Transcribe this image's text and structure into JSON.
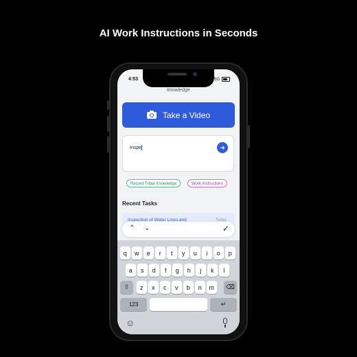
{
  "headline": "AI Work Instructions in Seconds",
  "status_bar": {
    "time": "4:53",
    "network": "5G",
    "icons": [
      "moon-icon",
      "signal-icon",
      "battery-icon"
    ]
  },
  "sub_label": "knowledge",
  "video_button": {
    "label": "Take a Video",
    "icon": "camera-icon"
  },
  "input": {
    "value": "Inspe",
    "send_icon": "arrow-right-icon"
  },
  "chips": [
    {
      "label": "Record Tribal Knowledge",
      "color": "#2f8c60"
    },
    {
      "label": "Work Instructions",
      "color": "#9c3e9e"
    }
  ],
  "recent": {
    "title": "Recent Tasks",
    "tasks": [
      {
        "name": "Inspection of Water Lines and",
        "date": "Today"
      }
    ]
  },
  "accessory": {
    "up": "⌃",
    "down": "⌄",
    "done": "✓"
  },
  "keyboard": {
    "row1": [
      "q",
      "w",
      "e",
      "r",
      "t",
      "y",
      "u",
      "i",
      "o",
      "p"
    ],
    "row2": [
      "a",
      "s",
      "d",
      "f",
      "g",
      "h",
      "j",
      "k",
      "l"
    ],
    "row3": [
      "z",
      "x",
      "c",
      "v",
      "b",
      "n",
      "m"
    ],
    "shift": "⇧",
    "delete": "⌫",
    "numbers": "123",
    "return": "↵",
    "emoji": "☺",
    "mic": "🎙"
  },
  "colors": {
    "accent": "#2e5bdb",
    "background": "#000000",
    "screen": "#f2f3f5"
  }
}
